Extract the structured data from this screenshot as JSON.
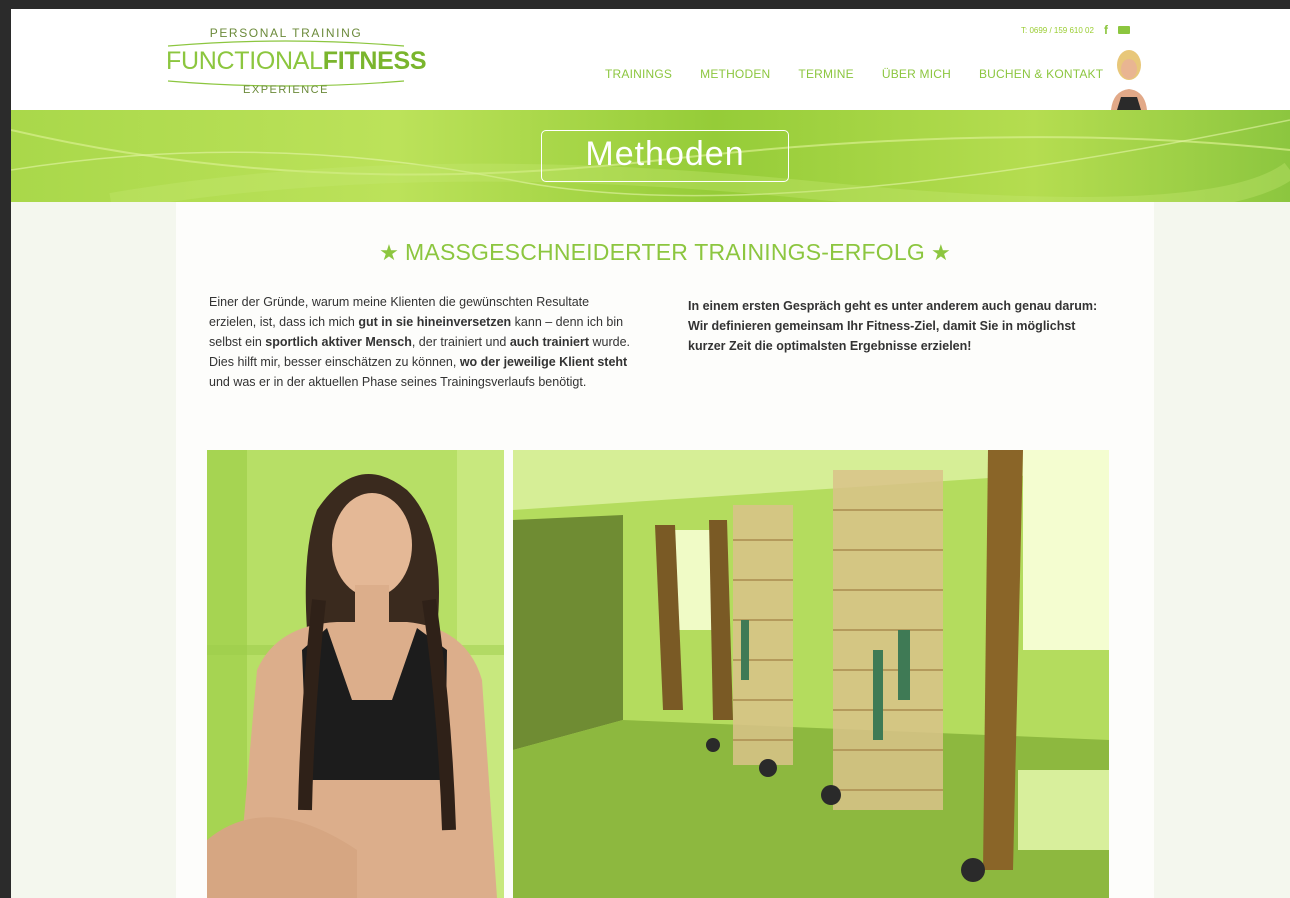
{
  "logo": {
    "top": "PERSONAL TRAINING",
    "main_light": "FUNCTIONAL",
    "main_bold": "FITNESS",
    "bottom": "EXPERIENCE"
  },
  "contact": {
    "phone": "T: 0699 / 159 610 02",
    "facebook_icon": "facebook-icon",
    "mail_icon": "mail-icon"
  },
  "nav": {
    "items": [
      {
        "label": "TRAININGS"
      },
      {
        "label": "METHODEN"
      },
      {
        "label": "TERMINE"
      },
      {
        "label": "ÜBER MICH"
      },
      {
        "label": "BUCHEN & KONTAKT"
      }
    ]
  },
  "banner": {
    "title": "Methoden"
  },
  "section": {
    "heading": "MASSGESCHNEIDERTER TRAININGS-ERFOLG",
    "star": "★",
    "col1": {
      "t1": "Einer der Gründe, warum meine Klienten die gewünschten Resultate erzielen, ist, dass ich mich ",
      "b1": "gut in sie hineinversetzen",
      "t2": " kann – denn ich bin selbst ein ",
      "b2": "sportlich aktiver Mensch",
      "t3": ", der trainiert und ",
      "b3": "auch trainiert",
      "t4": " wurde. Dies hilft mir, besser einschätzen zu können, ",
      "b4": "wo der jeweilige Klient steht",
      "t5": " und was er in der aktuellen Phase seines Trainingsverlaufs benötigt."
    },
    "col2": "In einem ersten Gespräch geht es unter anderem auch genau darum: Wir definieren gemeinsam Ihr Fitness-Ziel, damit Sie in möglichst kurzer Zeit die optimalsten Ergebnisse erzielen!"
  },
  "colors": {
    "accent": "#8cc63f",
    "text": "#333333"
  }
}
